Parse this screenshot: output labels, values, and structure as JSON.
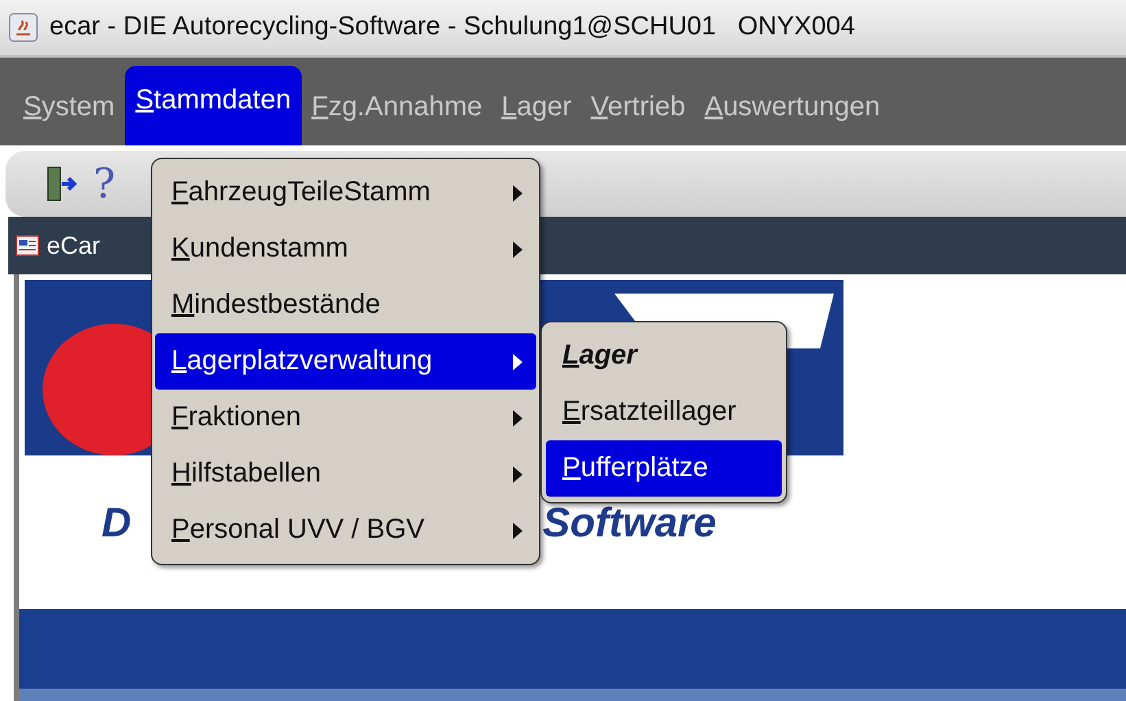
{
  "window": {
    "title": "ecar - DIE Autorecycling-Software - Schulung1@SCHU01   ONYX004"
  },
  "menu_bar": [
    {
      "label": "System",
      "selected": false
    },
    {
      "label": "Stammdaten",
      "selected": true
    },
    {
      "label": "Fzg.Annahme",
      "selected": false
    },
    {
      "label": "Lager",
      "selected": false
    },
    {
      "label": "Vertrieb",
      "selected": false
    },
    {
      "label": "Auswertungen",
      "selected": false
    }
  ],
  "toolbar": {
    "help": "?"
  },
  "inner_window": {
    "title": "eCar"
  },
  "logo": {
    "left_text": "D",
    "right_text": "Software"
  },
  "menu": [
    {
      "label": "FahrzeugTeileStamm",
      "submenu": true,
      "selected": false
    },
    {
      "label": "Kundenstamm",
      "submenu": true,
      "selected": false
    },
    {
      "label": "Mindestbestände",
      "submenu": false,
      "selected": false
    },
    {
      "label": "Lagerplatzverwaltung",
      "submenu": true,
      "selected": true
    },
    {
      "label": "Fraktionen",
      "submenu": true,
      "selected": false
    },
    {
      "label": "Hilfstabellen",
      "submenu": true,
      "selected": false
    },
    {
      "label": "Personal UVV / BGV",
      "submenu": true,
      "selected": false
    }
  ],
  "submenu": [
    {
      "label": "Lager",
      "bold": true,
      "selected": false
    },
    {
      "label": "Ersatzteillager",
      "bold": false,
      "selected": false
    },
    {
      "label": "Pufferplätze",
      "bold": false,
      "selected": true
    }
  ]
}
